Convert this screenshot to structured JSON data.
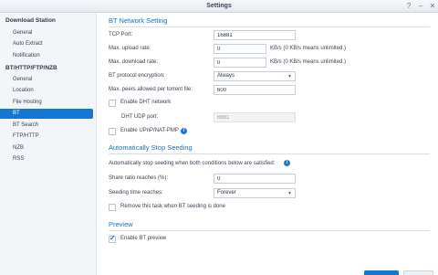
{
  "window": {
    "title": "Settings"
  },
  "sidebar": {
    "groups": [
      {
        "label": "Download Station",
        "items": [
          "General",
          "Auto Extract",
          "Notification"
        ]
      },
      {
        "label": "BT/HTTP/FTP/NZB",
        "items": [
          "General",
          "Location",
          "File Hosting",
          "BT",
          "BT Search",
          "FTP/HTTP",
          "NZB",
          "RSS"
        ]
      }
    ],
    "active_item": "BT"
  },
  "bt_network": {
    "title": "BT Network Setting",
    "tcp_port_label": "TCP Port:",
    "tcp_port_value": "16881",
    "upload_label": "Max. upload rate:",
    "upload_value": "0",
    "upload_hint": "KB/s (0 KB/s means unlimited.)",
    "download_label": "Max. download rate:",
    "download_value": "0",
    "download_hint": "KB/s (0 KB/s means unlimited.)",
    "encryption_label": "BT protocol encryption:",
    "encryption_value": "Always",
    "peers_label": "Max. peers allowed per torrent file:",
    "peers_value": "600",
    "dht_label": "Enable DHT network",
    "dht_checked": false,
    "dht_port_label": "DHT UDP port:",
    "dht_port_value": "6881",
    "upnp_label": "Enable UPnP/NAT-PMP",
    "upnp_checked": false
  },
  "auto_stop": {
    "title": "Automatically Stop Seeding",
    "description": "Automatically stop seeding when both conditions below are satisfied:",
    "ratio_label": "Share ratio reaches (%):",
    "ratio_value": "0",
    "time_label": "Seeding time reaches:",
    "time_value": "Forever",
    "remove_label": "Remove this task when BT seeding is done",
    "remove_checked": false
  },
  "preview": {
    "title": "Preview",
    "enable_label": "Enable BT preview",
    "enable_checked": true
  },
  "icons": {
    "help": "help-icon",
    "minimize": "minimize-icon",
    "close": "close-icon",
    "info": "info-icon",
    "dropdown": "chevron-down-icon",
    "check": "checkmark-icon"
  },
  "colors": {
    "accent": "#1577d3",
    "section_title": "#1b70c4"
  }
}
